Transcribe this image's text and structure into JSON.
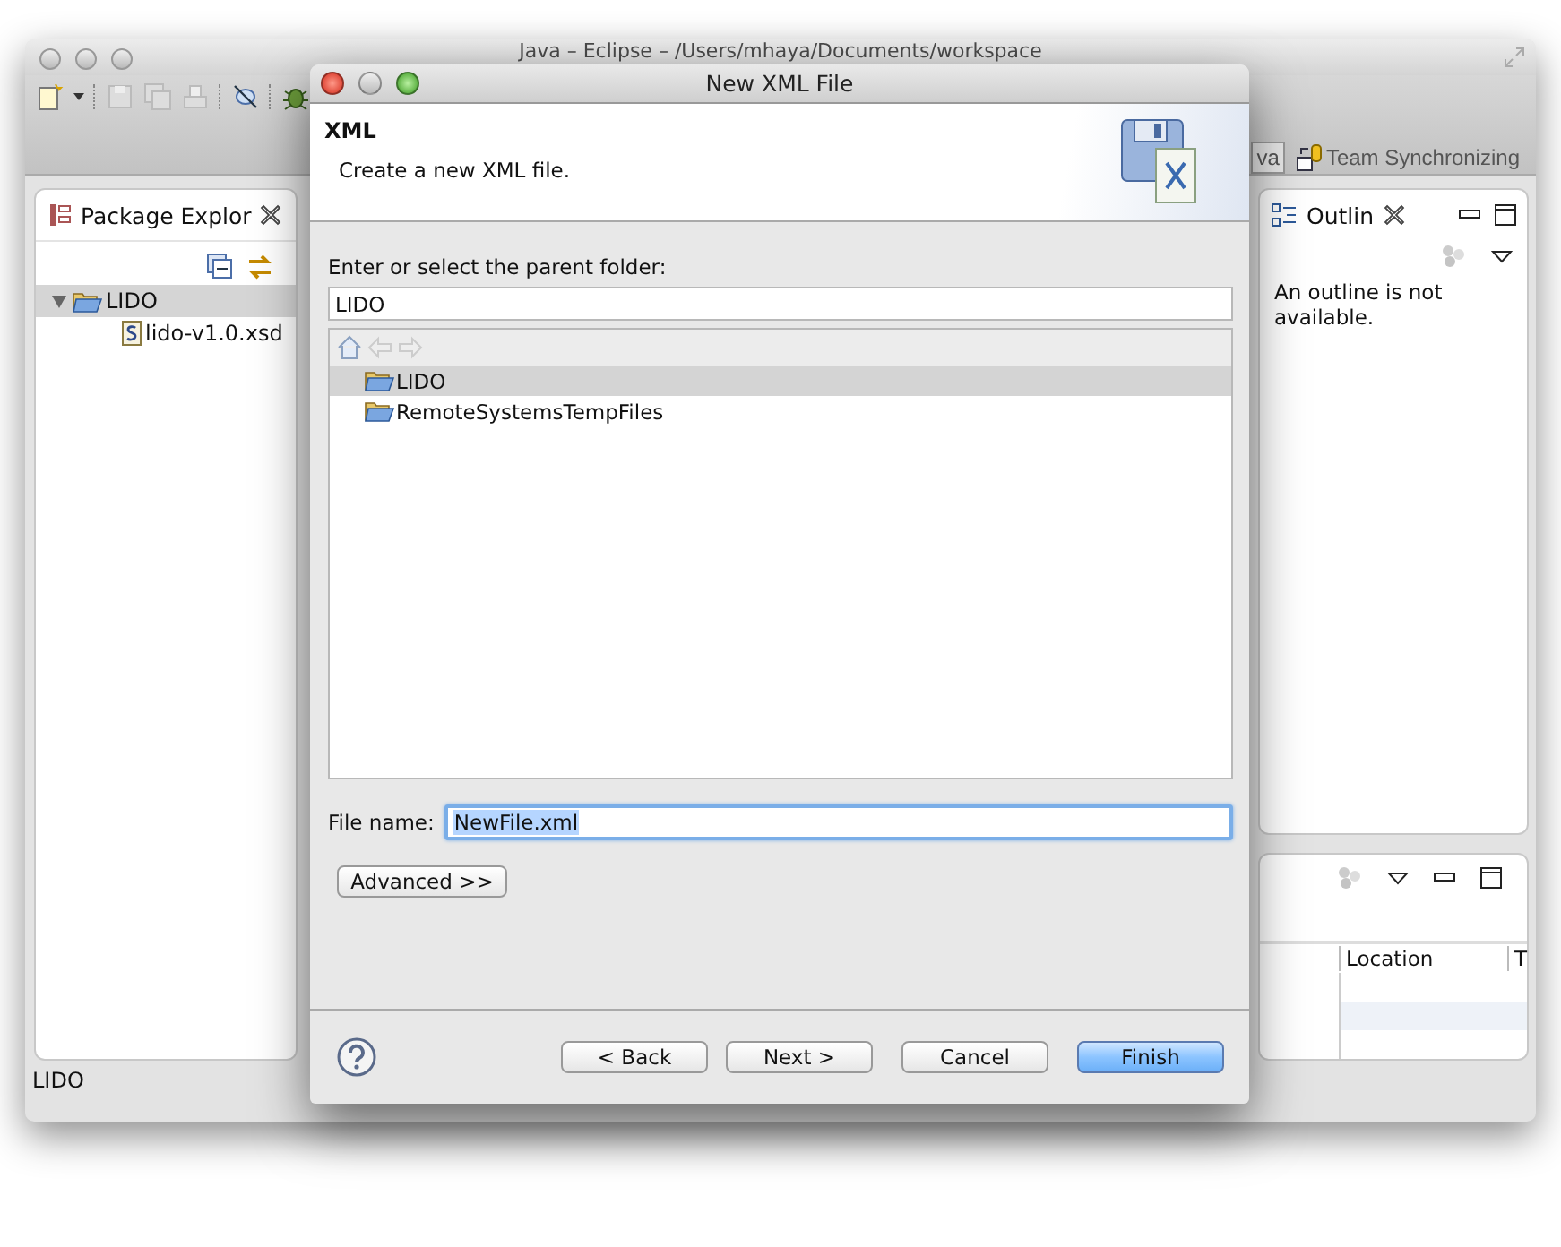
{
  "ide": {
    "title": "Java – Eclipse – /Users/mhaya/Documents/workspace",
    "perspectives": [
      {
        "label": "va",
        "selected": true
      },
      {
        "label": "Team Synchronizing",
        "selected": false
      }
    ],
    "package_explorer": {
      "tab": "Package Explor",
      "tree": [
        {
          "label": "LIDO",
          "kind": "folder",
          "expanded": true,
          "selected": true,
          "children": [
            {
              "label": "lido-v1.0.xsd",
              "kind": "schema",
              "selected": false
            }
          ]
        }
      ]
    },
    "outline": {
      "tab": "Outlin",
      "message": "An outline is not available."
    },
    "bottom_panel": {
      "columns": [
        "Location",
        "T"
      ]
    },
    "status_bar": "LIDO"
  },
  "dialog": {
    "title": "New XML File",
    "header_title": "XML",
    "header_description": "Create a new XML file.",
    "folder_label": "Enter or select the parent folder:",
    "folder_value": "LIDO",
    "folders": [
      {
        "label": "LIDO",
        "selected": true
      },
      {
        "label": "RemoteSystemsTempFiles",
        "selected": false
      }
    ],
    "file_name_label": "File name:",
    "file_name_value": "NewFile.xml",
    "file_name_text_selected": true,
    "advanced_button": "Advanced >>",
    "buttons": [
      {
        "label": "< Back",
        "default": false
      },
      {
        "label": "Next >",
        "default": false
      },
      {
        "label": "Cancel",
        "default": false
      },
      {
        "label": "Finish",
        "default": true
      }
    ]
  }
}
